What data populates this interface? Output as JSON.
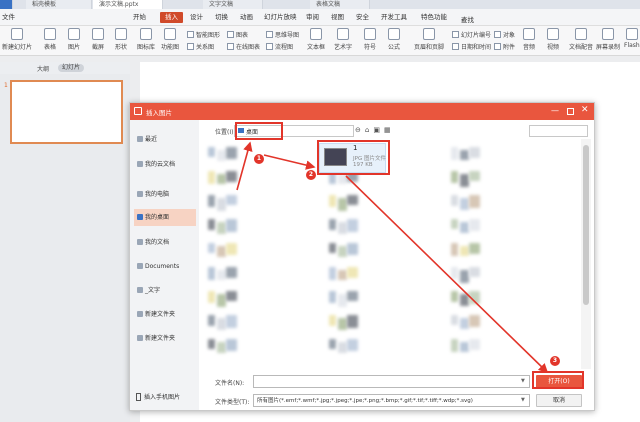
{
  "tabs": [
    "稻壳模板",
    "演示文稿.pptx",
    "文字文稿",
    "表格文稿"
  ],
  "menu": {
    "file": "文件",
    "items": [
      "开始",
      "插入",
      "设计",
      "切换",
      "动画",
      "幻灯片放映",
      "审阅",
      "视图",
      "安全",
      "开发工具",
      "特色功能"
    ],
    "active": "插入",
    "search": "查找"
  },
  "ribbon": {
    "big": [
      "新建幻灯片",
      "表格",
      "图片",
      "截屏",
      "形状",
      "图标库",
      "功能图",
      "文本框",
      "艺术字",
      "符号",
      "公式",
      "页眉和页脚",
      "音频",
      "视频",
      "文档配音",
      "屏幕录制",
      "Flash"
    ],
    "small": [
      "智能图形",
      "关系图",
      "图表",
      "在线图表",
      "思维导图",
      "流程图",
      "幻灯片编号",
      "对象",
      "日期和时间",
      "附件"
    ]
  },
  "panel": {
    "outline": "大纲",
    "slides": "幻灯片",
    "slide_num": "1"
  },
  "dialog": {
    "title": "插入图片",
    "places": [
      "最近",
      "我的云文档",
      "我的电脑",
      "我的桌面",
      "我的文档",
      "Documents",
      "_文字",
      "新建文件夹",
      "新建文件夹"
    ],
    "selected_place": "我的桌面",
    "mobile": "插入手机图片",
    "location_label": "位置(I):",
    "location_value": "桌面",
    "selected_file": {
      "name": "1",
      "type": "JPG 图片文件",
      "size": "197 KB"
    },
    "filename_label": "文件名(N):",
    "filename_value": "",
    "filetype_label": "文件类型(T):",
    "filetype_value": "所有图片(*.emf;*.wmf;*.jpg;*.jpeg;*.jpe;*.png;*.bmp;*.gif;*.tif;*.tiff;*.wdp;*.svg)",
    "open_label": "打开(O)",
    "cancel_label": "取消"
  },
  "annotations": [
    "1",
    "2",
    "3"
  ],
  "colors": {
    "accent": "#e9563e",
    "annotation": "#e2352a"
  }
}
